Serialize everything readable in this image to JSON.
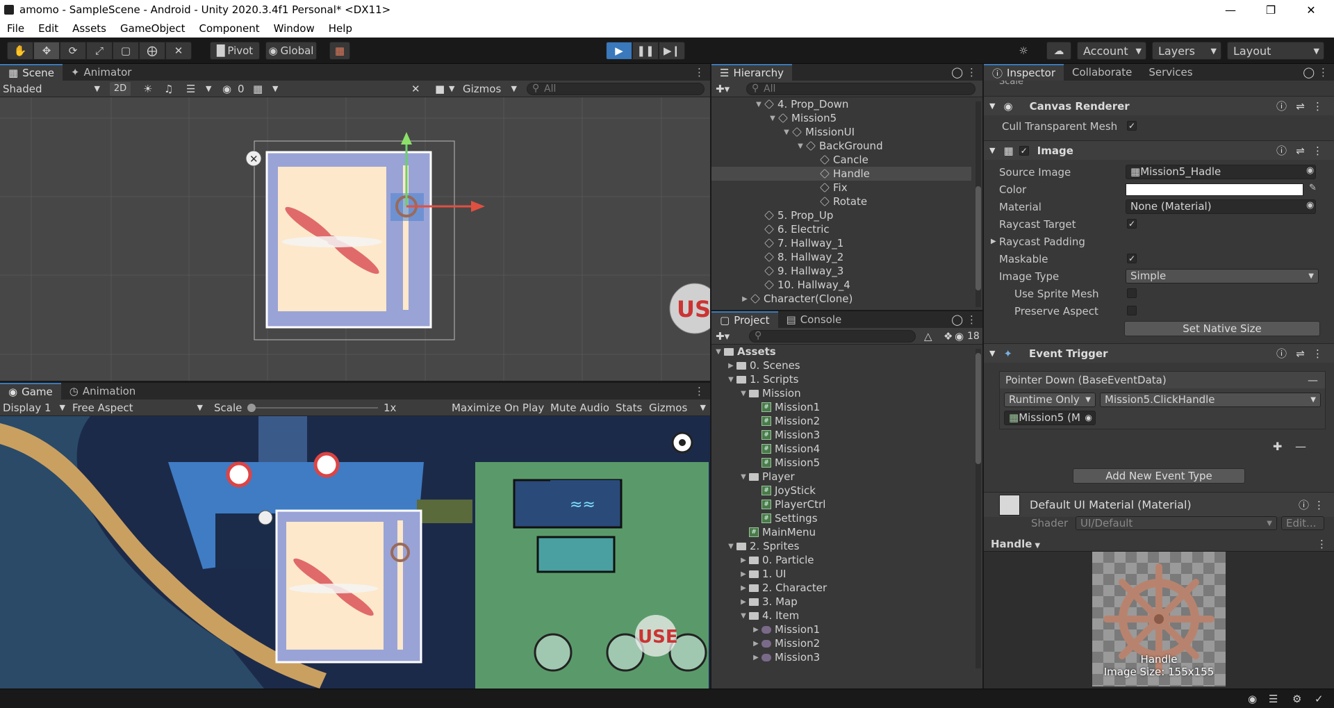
{
  "window": {
    "title": "amomo - SampleScene - Android - Unity 2020.3.4f1 Personal* <DX11>"
  },
  "menu": [
    "File",
    "Edit",
    "Assets",
    "GameObject",
    "Component",
    "Window",
    "Help"
  ],
  "toolbar": {
    "pivot": "Pivot",
    "global": "Global",
    "account": "Account",
    "layers": "Layers",
    "layout": "Layout"
  },
  "scene": {
    "tabs": [
      "Scene",
      "Animator"
    ],
    "shading": "Shaded",
    "mode2d": "2D",
    "hidden_count": "0",
    "gizmos": "Gizmos",
    "search_placeholder": "All",
    "use_label": "USE"
  },
  "game": {
    "tabs": [
      "Game",
      "Animation"
    ],
    "display": "Display 1",
    "aspect": "Free Aspect",
    "scale_label": "Scale",
    "scale_value": "1x",
    "scale_level": 0,
    "maximize": "Maximize On Play",
    "mute": "Mute Audio",
    "stats": "Stats",
    "gizmos": "Gizmos",
    "use_label": "USE"
  },
  "hierarchy": {
    "tab": "Hierarchy",
    "search_placeholder": "All",
    "items": [
      {
        "label": "4. Prop_Down",
        "depth": 0,
        "caret": "open"
      },
      {
        "label": "Mission5",
        "depth": 1,
        "caret": "open"
      },
      {
        "label": "MissionUI",
        "depth": 2,
        "caret": "open"
      },
      {
        "label": "BackGround",
        "depth": 3,
        "caret": "open"
      },
      {
        "label": "Cancle",
        "depth": 4,
        "caret": ""
      },
      {
        "label": "Handle",
        "depth": 4,
        "caret": "",
        "selected": true
      },
      {
        "label": "Fix",
        "depth": 4,
        "caret": ""
      },
      {
        "label": "Rotate",
        "depth": 4,
        "caret": ""
      },
      {
        "label": "5. Prop_Up",
        "depth": 0,
        "caret": ""
      },
      {
        "label": "6. Electric",
        "depth": 0,
        "caret": ""
      },
      {
        "label": "7. Hallway_1",
        "depth": 0,
        "caret": ""
      },
      {
        "label": "8. Hallway_2",
        "depth": 0,
        "caret": ""
      },
      {
        "label": "9. Hallway_3",
        "depth": 0,
        "caret": ""
      },
      {
        "label": "10. Hallway_4",
        "depth": 0,
        "caret": ""
      },
      {
        "label": "Character(Clone)",
        "depth": -1,
        "caret": "closed"
      }
    ]
  },
  "project": {
    "tabs": [
      "Project",
      "Console"
    ],
    "hidden_count": "18",
    "items": [
      {
        "label": "Assets",
        "depth": 0,
        "caret": "open",
        "icon": "folder",
        "bold": true
      },
      {
        "label": "0. Scenes",
        "depth": 1,
        "caret": "closed",
        "icon": "folder"
      },
      {
        "label": "1. Scripts",
        "depth": 1,
        "caret": "open",
        "icon": "folder"
      },
      {
        "label": "Mission",
        "depth": 2,
        "caret": "open",
        "icon": "folder"
      },
      {
        "label": "Mission1",
        "depth": 3,
        "caret": "",
        "icon": "script"
      },
      {
        "label": "Mission2",
        "depth": 3,
        "caret": "",
        "icon": "script"
      },
      {
        "label": "Mission3",
        "depth": 3,
        "caret": "",
        "icon": "script"
      },
      {
        "label": "Mission4",
        "depth": 3,
        "caret": "",
        "icon": "script"
      },
      {
        "label": "Mission5",
        "depth": 3,
        "caret": "",
        "icon": "script"
      },
      {
        "label": "Player",
        "depth": 2,
        "caret": "open",
        "icon": "folder"
      },
      {
        "label": "JoyStick",
        "depth": 3,
        "caret": "",
        "icon": "script"
      },
      {
        "label": "PlayerCtrl",
        "depth": 3,
        "caret": "",
        "icon": "script"
      },
      {
        "label": "Settings",
        "depth": 3,
        "caret": "",
        "icon": "script"
      },
      {
        "label": "MainMenu",
        "depth": 2,
        "caret": "",
        "icon": "script"
      },
      {
        "label": "2. Sprites",
        "depth": 1,
        "caret": "open",
        "icon": "folder"
      },
      {
        "label": "0. Particle",
        "depth": 2,
        "caret": "closed",
        "icon": "folder"
      },
      {
        "label": "1. UI",
        "depth": 2,
        "caret": "closed",
        "icon": "folder"
      },
      {
        "label": "2. Character",
        "depth": 2,
        "caret": "closed",
        "icon": "folder"
      },
      {
        "label": "3. Map",
        "depth": 2,
        "caret": "closed",
        "icon": "folder"
      },
      {
        "label": "4. Item",
        "depth": 2,
        "caret": "open",
        "icon": "folder"
      },
      {
        "label": "Mission1",
        "depth": 3,
        "caret": "closed",
        "icon": "sprite"
      },
      {
        "label": "Mission2",
        "depth": 3,
        "caret": "closed",
        "icon": "sprite"
      },
      {
        "label": "Mission3",
        "depth": 3,
        "caret": "closed",
        "icon": "sprite"
      }
    ]
  },
  "inspector": {
    "tabs": [
      "Inspector",
      "Collaborate",
      "Services"
    ],
    "top_label": "Scale",
    "canvas_renderer": {
      "title": "Canvas Renderer",
      "cull_label": "Cull Transparent Mesh",
      "cull_checked": true
    },
    "image": {
      "title": "Image",
      "source_label": "Source Image",
      "source_value": "Mission5_Hadle",
      "color_label": "Color",
      "color_value": "#ffffff",
      "material_label": "Material",
      "material_value": "None (Material)",
      "raycast_label": "Raycast Target",
      "padding_label": "Raycast Padding",
      "maskable_label": "Maskable",
      "type_label": "Image Type",
      "type_value": "Simple",
      "sprite_mesh_label": "Use Sprite Mesh",
      "preserve_label": "Preserve Aspect",
      "native_button": "Set Native Size"
    },
    "event_trigger": {
      "title": "Event Trigger",
      "entry": "Pointer Down (BaseEventData)",
      "runtime": "Runtime Only",
      "function": "Mission5.ClickHandle",
      "object": "Mission5 (M",
      "add_button": "Add New Event Type"
    },
    "material": {
      "title": "Default UI Material (Material)",
      "shader_label": "Shader",
      "shader_value": "UI/Default",
      "edit_button": "Edit..."
    }
  },
  "preview": {
    "object_name": "Handle",
    "caption_name": "Handle",
    "caption_size": "Image Size: 155x155"
  },
  "colors": {
    "accent": "#3a79bb",
    "play_active": "#3a79bb",
    "panel": "#383838",
    "canvas_bg": "#9aa3d6",
    "paper": "#fde8cb",
    "propeller": "#e06a6a",
    "wheel": "#9a6a5a"
  }
}
